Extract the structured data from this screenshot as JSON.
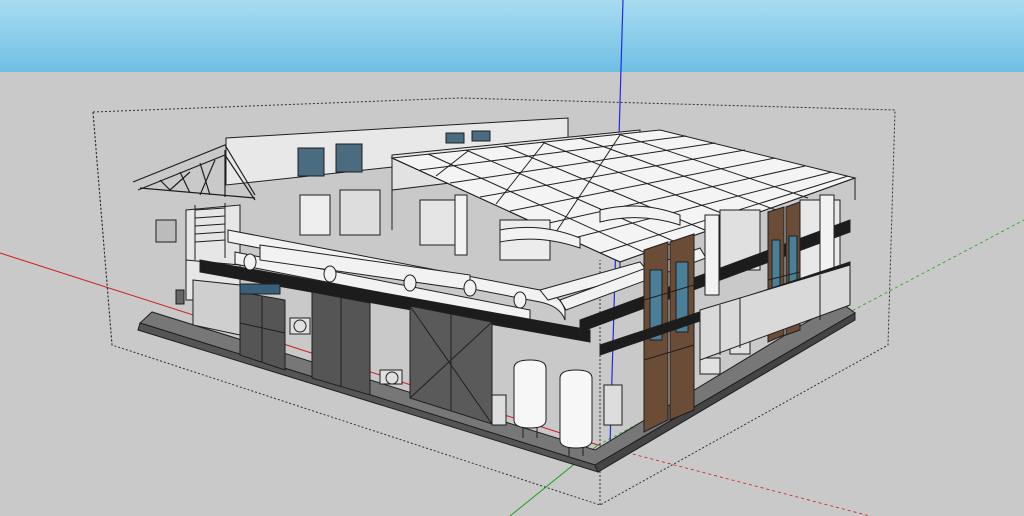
{
  "viewport": {
    "sky_color": "#6fbfe4",
    "sky_top_color": "#a9dcf1",
    "ground_color": "#c9c9c9",
    "model_line_color": "#1f1f1f",
    "model_fill_color": "#ffffff"
  },
  "axes": {
    "red_axis_color": "#d11a1a",
    "green_axis_color": "#1aa31a",
    "blue_axis_color": "#1f2fd6"
  },
  "selection": {
    "bounding_box_style": "dotted"
  }
}
